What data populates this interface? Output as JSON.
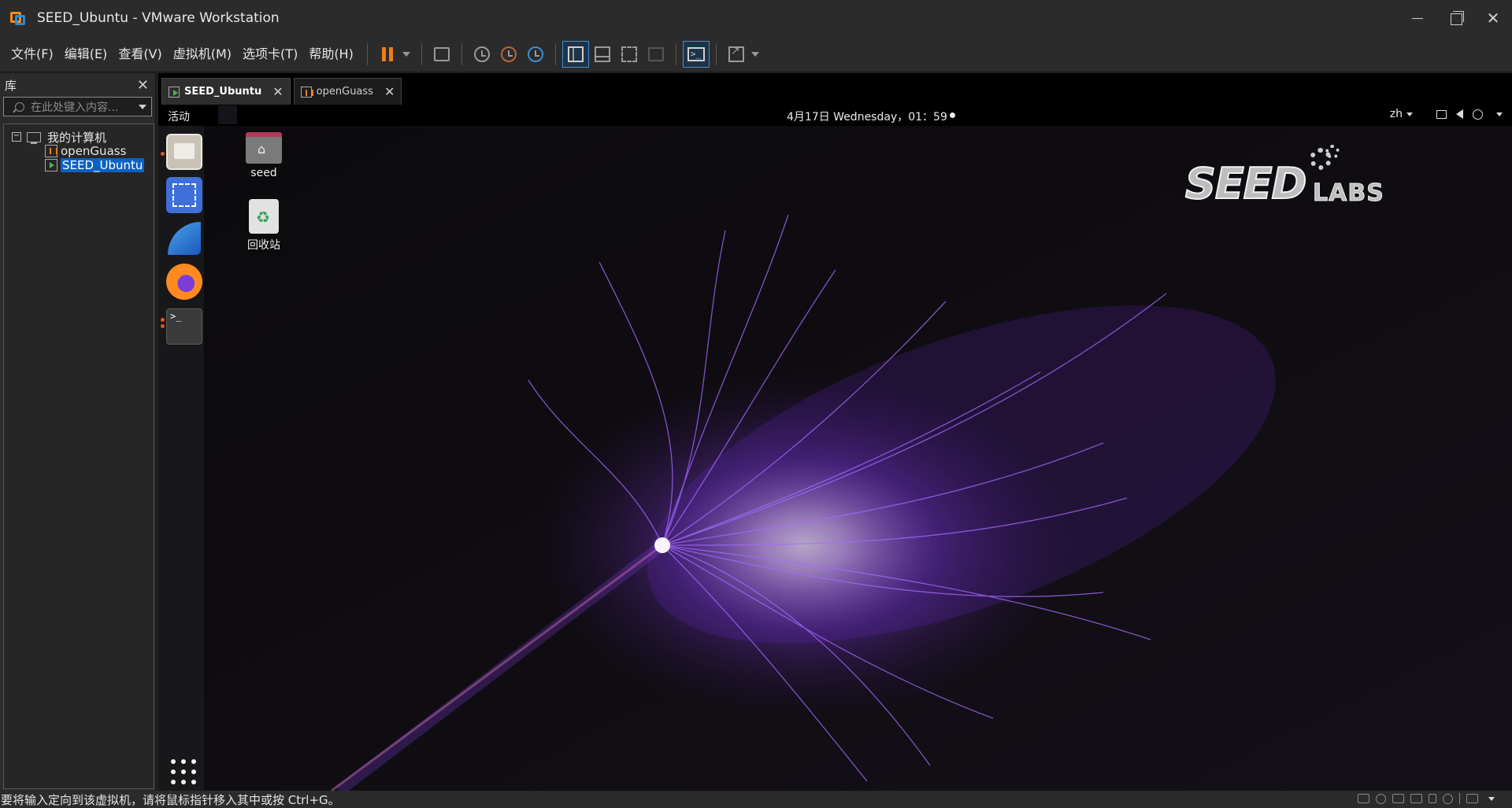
{
  "window": {
    "title": "SEED_Ubuntu - VMware Workstation",
    "controls": [
      "minimize-icon",
      "restore-icon",
      "close-icon"
    ],
    "close_glyph": "✕"
  },
  "menu": {
    "items": [
      "文件(F)",
      "编辑(E)",
      "查看(V)",
      "虚拟机(M)",
      "选项卡(T)",
      "帮助(H)"
    ]
  },
  "toolbar": {
    "icons": [
      "pause-icon",
      "send-keys-icon",
      "snapshot-icon",
      "revert-snapshot-icon",
      "snapshot-manager-icon",
      "library-layout-icon",
      "thumbnail-layout-icon",
      "fullscreen-icon",
      "unity-icon",
      "console-icon",
      "stretch-icon"
    ],
    "console_glyph": ">_",
    "accent": "#f07b16"
  },
  "library": {
    "title": "库",
    "close_glyph": "✕",
    "search_placeholder": "在此处键入内容...",
    "tree": {
      "root_label": "我的计算机",
      "expander_glyph": "−",
      "children": [
        "openGuass",
        "SEED_Ubuntu"
      ],
      "selected": "SEED_Ubuntu"
    }
  },
  "tabs": [
    {
      "label": "SEED_Ubuntu",
      "active": true
    },
    {
      "label": "openGuass",
      "active": false
    }
  ],
  "tab_close_glyph": "✕",
  "ubuntu": {
    "activities": "活动",
    "clock": "4月17日 Wednesday，01：59",
    "lang": "zh",
    "tray_icons": [
      "network-icon",
      "volume-icon",
      "power-icon"
    ],
    "dock": [
      "files-icon",
      "screenshot-icon",
      "wireshark-icon",
      "firefox-icon",
      "terminal-icon"
    ],
    "terminal_glyph": ">_",
    "desktop_icons": [
      {
        "label": "seed",
        "icon": "home-folder-icon"
      },
      {
        "label": "回收站",
        "icon": "trash-icon"
      }
    ],
    "logo": {
      "seed": "SEED",
      "labs": "LABS"
    },
    "accent": "#8a3ff0"
  },
  "status": {
    "text": "要将输入定向到该虚拟机，请将鼠标指针移入其中或按 Ctrl+G。",
    "icons": [
      "hdd-icon",
      "cd-icon",
      "network-adapter-icon",
      "printer-icon",
      "sound-icon",
      "usb-icon",
      "message-icon"
    ]
  }
}
